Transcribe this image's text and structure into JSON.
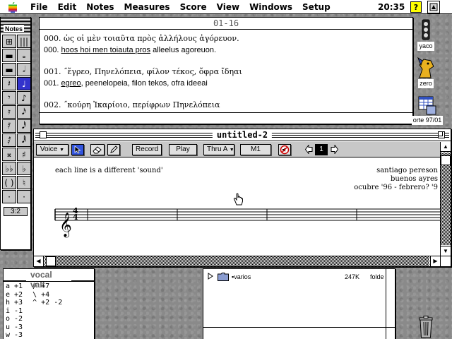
{
  "menubar": {
    "items": [
      "File",
      "Edit",
      "Notes",
      "Measures",
      "Score",
      "View",
      "Windows",
      "Setup"
    ],
    "clock": "20:35",
    "help_glyph": "?"
  },
  "palette": {
    "title": "Notes",
    "ratio": "3:2",
    "cells": [
      "⊞",
      "|||",
      "▬",
      "𝅝",
      "▬",
      "𝅗𝅥",
      "𝄽",
      "♩",
      "𝄾",
      "♪",
      "𝄿",
      "𝅘𝅥𝅯",
      "𝅀",
      "𝅘𝅥𝅰",
      "𝅁",
      "𝅘𝅥𝅱",
      "𝄪",
      "♯",
      "♭♭",
      "♭",
      "( )",
      "♮",
      "·",
      "·"
    ]
  },
  "text_window": {
    "title": "01-16",
    "lines": [
      {
        "text": "000. ὡς οἱ μὲν τοιαῦτα πρὸς ἀλλήλους ἀγόρευον.",
        "latin": false
      },
      {
        "prefix": "000. ",
        "underlined": "hoos hoi men toiauta pros",
        "suffix": " alleelus agoreuon.",
        "latin": true
      },
      {
        "gap": true
      },
      {
        "text": "001. ˝ἔγρεο, Πηνελόπεια, φίλον τέκος, ὄφρα ἴδηαι",
        "latin": false
      },
      {
        "prefix": "001. ",
        "underlined": "egreo",
        "suffix": ", peenelopeia, filon tekos, ofra ideeai",
        "latin": true
      },
      {
        "gap": true
      },
      {
        "text": "002. ˝κούρη Ἰκαρίοιο, περίφρων Πηνελόπεια",
        "latin": false
      }
    ]
  },
  "score_window": {
    "title": "untitled-2",
    "toolbar": {
      "voice": "Voice",
      "record": "Record",
      "play": "Play",
      "thru": "Thru A",
      "m1": "M1",
      "page_number": "1"
    },
    "subtitle": "each line is a different 'sound'",
    "credits": [
      "santiago pereson",
      "buenos ayres",
      "ocubre '96 - febrero? '9"
    ],
    "time_signature": {
      "top": "4",
      "bottom": "4"
    },
    "measures": 4
  },
  "vocal_window": {
    "title": "vocal valt",
    "col1": [
      "a +1",
      "e +2",
      "h +3",
      "i -1",
      "o -2",
      "u -3",
      "w -3"
    ],
    "col2": [
      "/ +7",
      "\\ +4",
      "^ +2 -2"
    ]
  },
  "finder_window": {
    "row": {
      "name": "varios",
      "size": "247K",
      "kind": "folde"
    }
  },
  "desktop_icons": [
    {
      "label": "yaco"
    },
    {
      "label": "zero"
    },
    {
      "label": "orte 97/01"
    }
  ],
  "colors": {
    "desktop": "#8a8a8a",
    "toolbar": "#c8c8c8",
    "selection": "#3333cc",
    "finder_folder": "#8a9cd0"
  }
}
